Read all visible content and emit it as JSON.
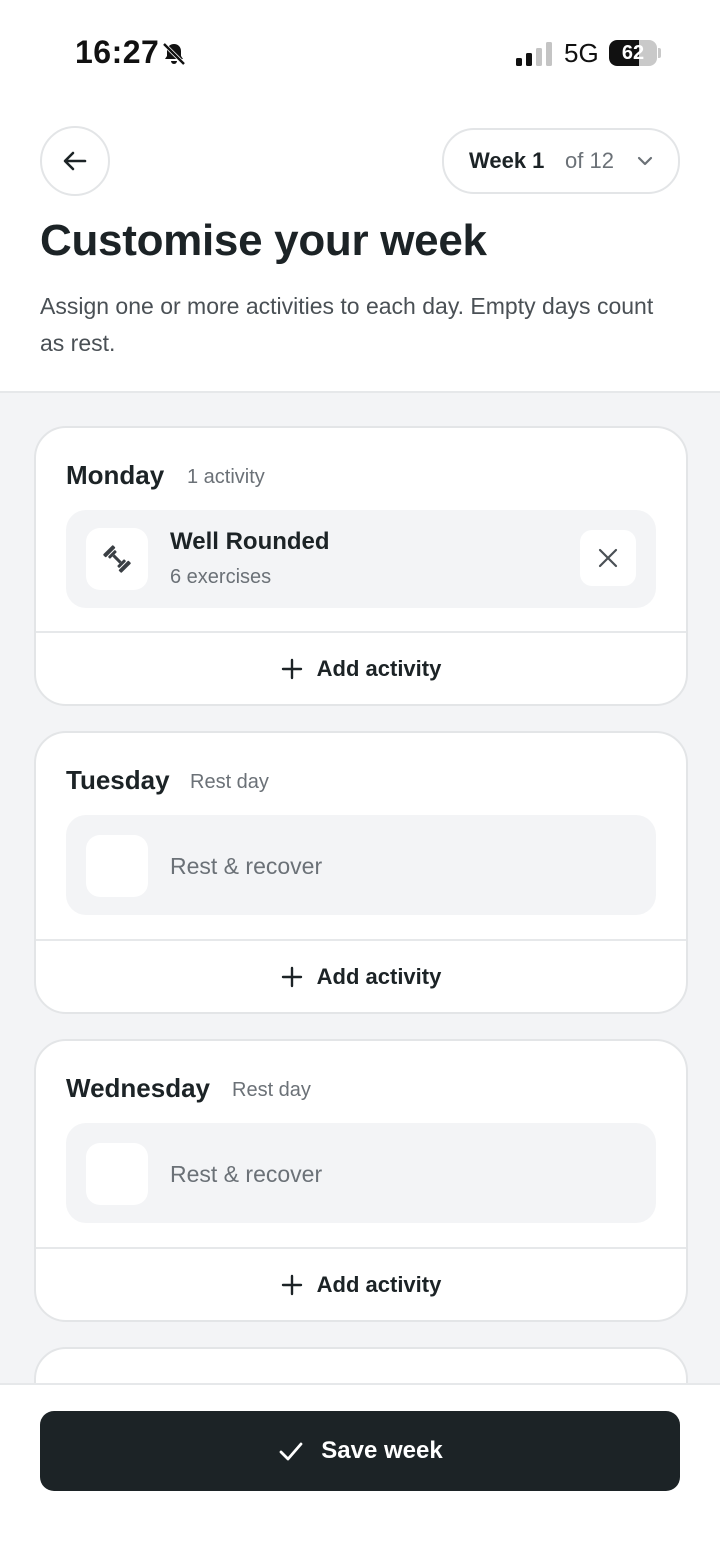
{
  "status_bar": {
    "time": "16:27",
    "network": "5G",
    "battery_percent": 62,
    "battery_text": "62",
    "icons": [
      "bell-slash-icon",
      "signal-icon",
      "battery-icon"
    ]
  },
  "header": {
    "back_icon": "arrow-left-icon",
    "week_label": "Week 1",
    "week_total": "of 12",
    "week_icon": "chevron-down-icon",
    "title": "Customise your week",
    "subtitle": "Assign one or more activities to each day. Empty days count as rest."
  },
  "days": [
    {
      "name": "Monday",
      "meta": "1 activity",
      "activity": {
        "title": "Well Rounded",
        "subtitle": "6 exercises",
        "icon": "dumbbell-icon",
        "remove_icon": "close-icon"
      },
      "add_label": "Add activity"
    },
    {
      "name": "Tuesday",
      "meta": "Rest day",
      "rest": {
        "label": "Rest & recover",
        "icon": "moon-icon"
      },
      "add_label": "Add activity"
    },
    {
      "name": "Wednesday",
      "meta": "Rest day",
      "rest": {
        "label": "Rest & recover",
        "icon": "moon-icon"
      },
      "add_label": "Add activity"
    }
  ],
  "footer": {
    "save_label": "Save week",
    "save_icon": "check-icon"
  },
  "colors": {
    "primary_dark": "#1c2326",
    "background_gray": "#f3f4f6",
    "muted_text": "#6b7177",
    "border": "#e3e5e7"
  }
}
